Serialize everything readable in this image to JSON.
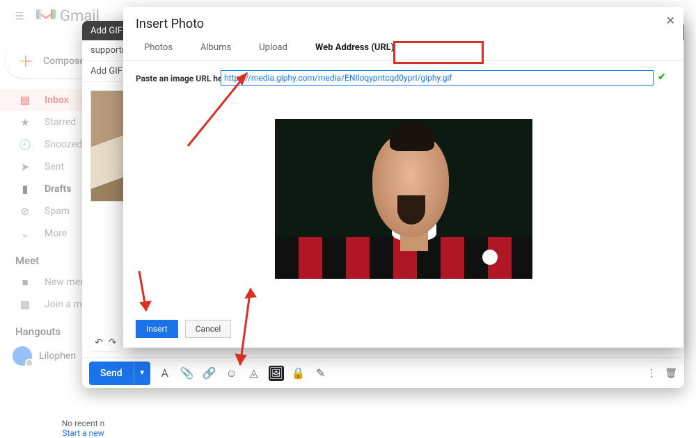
{
  "brand": {
    "name": "Gmail"
  },
  "sidebar": {
    "compose": "Compose",
    "items": [
      {
        "icon": "inbox-icon",
        "glyph": "▤",
        "label": "Inbox",
        "active": true
      },
      {
        "icon": "star-icon",
        "glyph": "★",
        "label": "Starred"
      },
      {
        "icon": "clock-icon",
        "glyph": "🕘",
        "label": "Snoozed"
      },
      {
        "icon": "send-icon",
        "glyph": "➤",
        "label": "Sent"
      },
      {
        "icon": "draft-icon",
        "glyph": "▮",
        "label": "Drafts",
        "bold": true
      },
      {
        "icon": "spam-icon",
        "glyph": "⊘",
        "label": "Spam"
      },
      {
        "icon": "chevron-down-icon",
        "glyph": "⌄",
        "label": "More"
      }
    ],
    "meet_label": "Meet",
    "meet": [
      {
        "icon": "video-icon",
        "glyph": "■",
        "label": "New meeting"
      },
      {
        "icon": "grid-icon",
        "glyph": "▦",
        "label": "Join a meeting"
      }
    ],
    "hangouts_label": "Hangouts",
    "user": {
      "name": "Lilophen"
    },
    "no_recent": "No recent n",
    "start_new": "Start a new"
  },
  "compose_window": {
    "header": "Add GIF t",
    "to": "support@",
    "subject": "Add GIF to",
    "send": "Send"
  },
  "toolbar_icons": [
    {
      "name": "format-icon",
      "glyph": "A"
    },
    {
      "name": "attach-icon",
      "glyph": "📎"
    },
    {
      "name": "link-icon",
      "glyph": "🔗"
    },
    {
      "name": "emoji-icon",
      "glyph": "☺"
    },
    {
      "name": "drive-icon",
      "glyph": "◬"
    },
    {
      "name": "image-icon",
      "glyph": "🖼",
      "highlight": true
    },
    {
      "name": "confidential-icon",
      "glyph": "🔒"
    },
    {
      "name": "signature-icon",
      "glyph": "✎"
    }
  ],
  "modal": {
    "title": "Insert Photo",
    "tabs": [
      {
        "label": "Photos"
      },
      {
        "label": "Albums"
      },
      {
        "label": "Upload"
      },
      {
        "label": "Web Address (URL)",
        "active": true
      }
    ],
    "url_label": "Paste an image URL here:",
    "url_value": "https://media.giphy.com/media/ENIloqypntcqd0yprI/giphy.gif",
    "insert": "Insert",
    "cancel": "Cancel"
  }
}
